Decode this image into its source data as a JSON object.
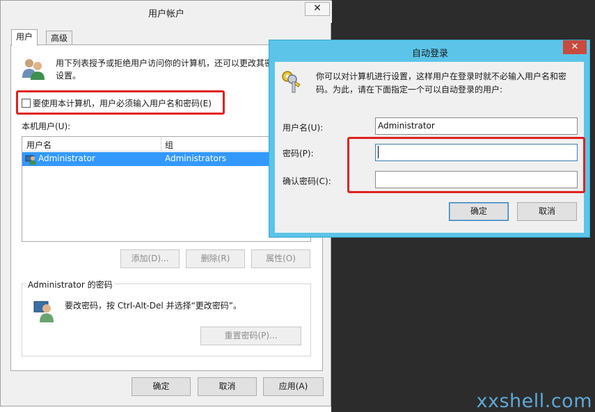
{
  "main_window": {
    "title": "用户帐户",
    "close_glyph": "✕",
    "tabs": [
      {
        "label": "用户",
        "active": true
      },
      {
        "label": "高级",
        "active": false
      }
    ],
    "intro_line1": "用下列表授予或拒绝用户访问你的计算机，还可以更改其密",
    "intro_line2": "设置。",
    "checkbox_label": "要使用本计算机，用户必须输入用户名和密码(E)",
    "checkbox_checked": false,
    "local_users_label": "本机用户(U):",
    "columns": [
      "用户名",
      "组"
    ],
    "rows": [
      {
        "username": "Administrator",
        "group": "Administrators",
        "selected": true
      }
    ],
    "buttons": {
      "add": "添加(D)...",
      "remove": "删除(R)",
      "properties": "属性(O)"
    },
    "password_group": {
      "title": "Administrator 的密码",
      "text": "要改密码，按 Ctrl-Alt-Del 并选择“更改密码”。",
      "reset_button": "重置密码(P)..."
    },
    "footer_buttons": {
      "ok": "确定",
      "cancel": "取消",
      "apply": "应用(A)"
    }
  },
  "auto_logon": {
    "title": "自动登录",
    "close_glyph": "✕",
    "desc_line1": "你可以对计算机进行设置，这样用户在登录时就不必输入用户名和密",
    "desc_line2": "码。为此，请在下面指定一个可以自动登录的用户:",
    "username_label": "用户名(U):",
    "username_value": "Administrator",
    "password_label": "密码(P):",
    "password_value": "",
    "confirm_label": "确认密码(C):",
    "confirm_value": "",
    "ok": "确定",
    "cancel": "取消"
  },
  "watermark": "xxshell.com",
  "colors": {
    "highlight": "#e02020",
    "selection": "#3399ff",
    "dialog_frame": "#5bc4e8",
    "close_button": "#c74b3f",
    "watermark": "#5fa8d8"
  }
}
